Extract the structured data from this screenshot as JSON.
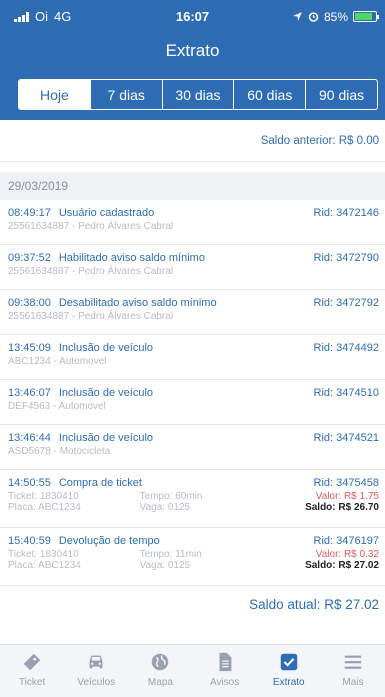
{
  "status": {
    "carrier": "Oi",
    "network": "4G",
    "time": "16:07",
    "battery": "85%",
    "battery_level": 0.85
  },
  "header": {
    "title": "Extrato"
  },
  "tabs": [
    {
      "label": "Hoje",
      "active": true
    },
    {
      "label": "7 dias",
      "active": false
    },
    {
      "label": "30 dias",
      "active": false
    },
    {
      "label": "60 dias",
      "active": false
    },
    {
      "label": "90 dias",
      "active": false
    }
  ],
  "saldo_anterior": "Saldo anterior: R$ 0.00",
  "date": "29/03/2019",
  "entries": [
    {
      "time": "08:49:17",
      "title": "Usuário cadastrado",
      "rid": "Rid: 3472146",
      "sub": "25561634887 - Pedro Álvares Cabral"
    },
    {
      "time": "09:37:52",
      "title": "Habilitado aviso saldo mínimo",
      "rid": "Rid: 3472790",
      "sub": "25561634887 - Pedro Álvares Cabral"
    },
    {
      "time": "09:38:00",
      "title": "Desabilitado aviso saldo mínimo",
      "rid": "Rid: 3472792",
      "sub": "25561634887 - Pedro Álvares Cabral"
    },
    {
      "time": "13:45:09",
      "title": "Inclusão de veículo",
      "rid": "Rid: 3474492",
      "sub": "ABC1234 - Automovel"
    },
    {
      "time": "13:46:07",
      "title": "Inclusão de veículo",
      "rid": "Rid: 3474510",
      "sub": "DEF4563 - Automovel"
    },
    {
      "time": "13:46:44",
      "title": "Inclusão de veículo",
      "rid": "Rid: 3474521",
      "sub": "ASD5678 - Motocicleta"
    }
  ],
  "tickets": [
    {
      "time": "14:50:55",
      "title": "Compra de ticket",
      "rid": "Rid: 3475458",
      "ticket": "Ticket: 1830410",
      "tempo": "Tempo: 60min",
      "valor": "Valor: R$ 1.75",
      "placa": "Placa: ABC1234",
      "vaga": "Vaga: 0125",
      "saldo": "Saldo: R$ 26.70"
    },
    {
      "time": "15:40:59",
      "title": "Devolução de tempo",
      "rid": "Rid: 3476197",
      "ticket": "Ticket: 1830410",
      "tempo": "Tempo: 11min",
      "valor": "Valor: R$ 0.32",
      "placa": "Placa: ABC1234",
      "vaga": "Vaga: 0125",
      "saldo": "Saldo: R$ 27.02"
    }
  ],
  "saldo_atual": "Saldo atual: R$ 27.02",
  "tabbar": [
    {
      "label": "Ticket",
      "icon": "ticket-icon",
      "active": false
    },
    {
      "label": "Veículos",
      "icon": "car-icon",
      "active": false
    },
    {
      "label": "Mapa",
      "icon": "globe-icon",
      "active": false
    },
    {
      "label": "Avisos",
      "icon": "document-icon",
      "active": false
    },
    {
      "label": "Extrato",
      "icon": "checkbox-icon",
      "active": true
    },
    {
      "label": "Mais",
      "icon": "menu-icon",
      "active": false
    }
  ],
  "colors": {
    "primary": "#2e6db4",
    "valor": "#e05b5b",
    "muted": "#b9bcc6"
  }
}
